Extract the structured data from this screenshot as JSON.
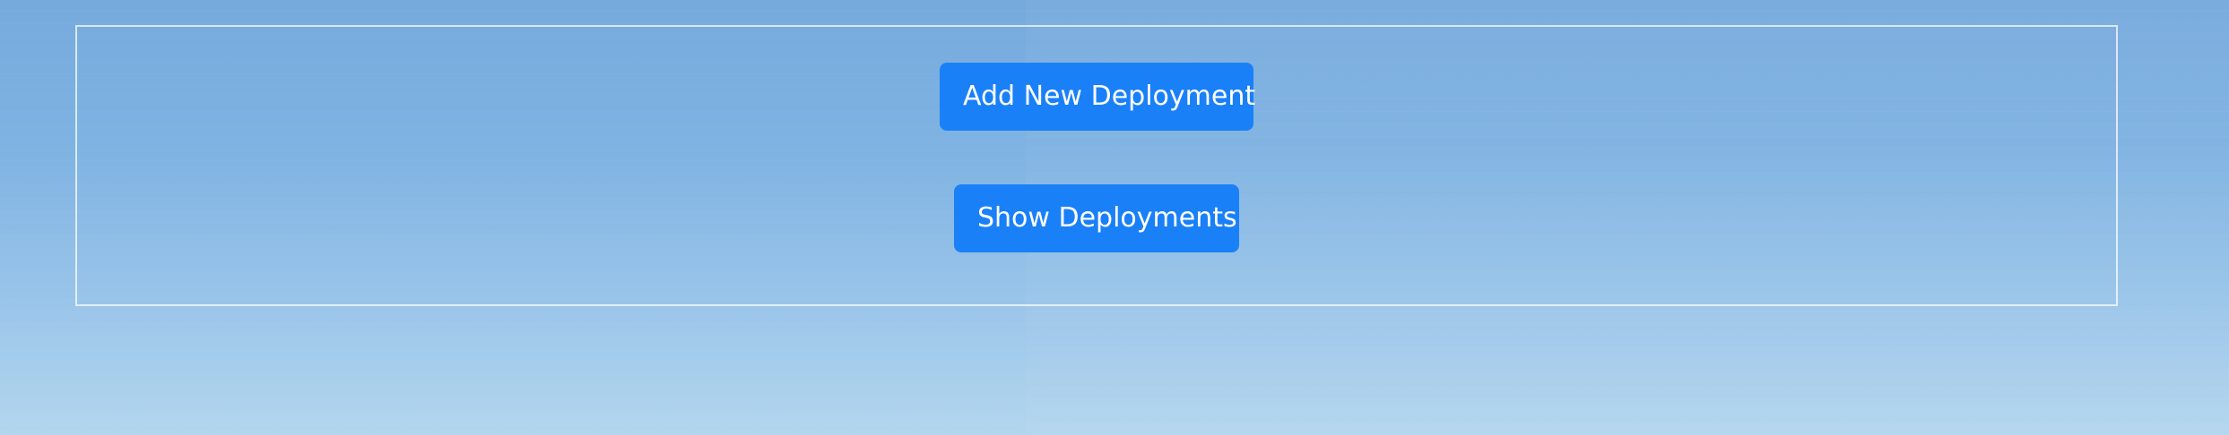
{
  "actions": {
    "add_label": "Add New Deployment",
    "show_label": "Show Deployments"
  },
  "colors": {
    "button_background": "#1a80f8",
    "button_text": "#ffffff",
    "panel_border": "#ffffff",
    "background_top": "#76aadd",
    "background_bottom": "#b3d6ee"
  }
}
